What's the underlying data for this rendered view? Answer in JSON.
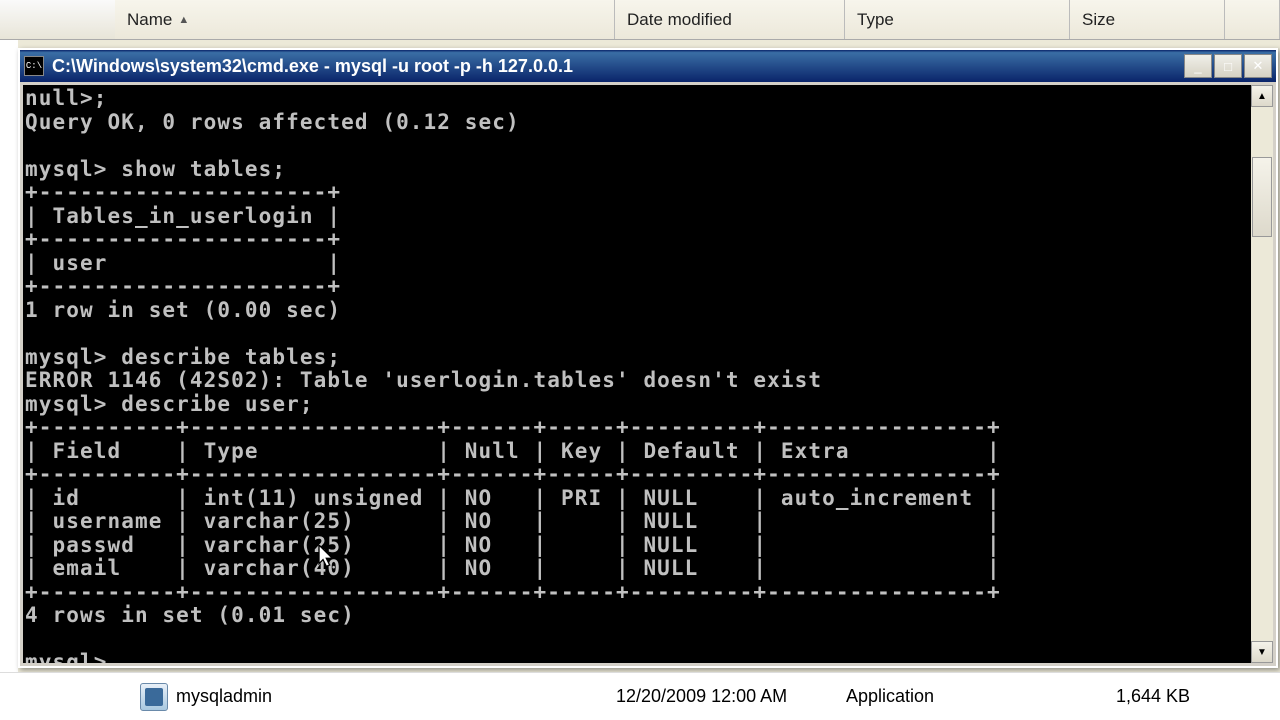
{
  "columns": {
    "name": "Name",
    "date": "Date modified",
    "type": "Type",
    "size": "Size"
  },
  "titlebar": {
    "icon_text": "C:\\",
    "text": "C:\\Windows\\system32\\cmd.exe - mysql  -u root -p -h 127.0.0.1"
  },
  "win_controls": {
    "minimize": "_",
    "maximize": "□",
    "close": "✕"
  },
  "terminal": {
    "lines": [
      "null>;",
      "Query OK, 0 rows affected (0.12 sec)",
      "",
      "mysql> show tables;",
      "+---------------------+",
      "| Tables_in_userlogin |",
      "+---------------------+",
      "| user                |",
      "+---------------------+",
      "1 row in set (0.00 sec)",
      "",
      "mysql> describe tables;",
      "ERROR 1146 (42S02): Table 'userlogin.tables' doesn't exist",
      "mysql> describe user;",
      "+----------+------------------+------+-----+---------+----------------+",
      "| Field    | Type             | Null | Key | Default | Extra          |",
      "+----------+------------------+------+-----+---------+----------------+",
      "| id       | int(11) unsigned | NO   | PRI | NULL    | auto_increment |",
      "| username | varchar(25)      | NO   |     | NULL    |                |",
      "| passwd   | varchar(25)      | NO   |     | NULL    |                |",
      "| email    | varchar(40)      | NO   |     | NULL    |                |",
      "+----------+------------------+------+-----+---------+----------------+",
      "4 rows in set (0.01 sec)",
      "",
      "mysql>"
    ]
  },
  "scroll": {
    "up": "▲",
    "down": "▼"
  },
  "file_row": {
    "name": "mysqladmin",
    "date": "12/20/2009 12:00 AM",
    "type": "Application",
    "size": "1,644 KB"
  }
}
